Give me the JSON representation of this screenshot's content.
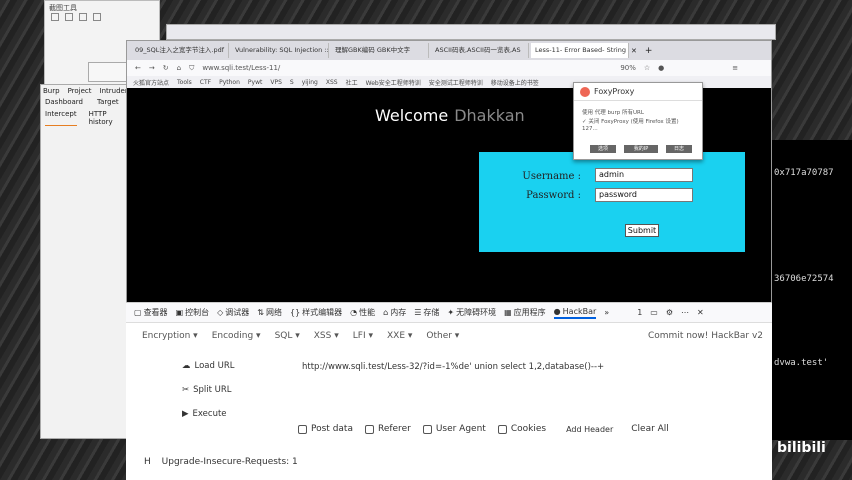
{
  "notes_window": {
    "title": "截图工具"
  },
  "browser": {
    "tabs": [
      {
        "label": "09_SQL注入之宽字节注入.pdf",
        "active": false
      },
      {
        "label": "Vulnerability: SQL Injection :: D",
        "active": false
      },
      {
        "label": "理解GBK编码 GBK中文字",
        "active": false
      },
      {
        "label": "ASCII码表,ASCII码一览表,AS",
        "active": false
      },
      {
        "label": "Less-11- Error Based- String",
        "active": true
      }
    ],
    "url": "www.sqli.test/Less-11/",
    "zoom": "90%",
    "bookmarks": [
      "火狐官方站点",
      "Tools",
      "CTF",
      "Python",
      "Pywt",
      "VPS",
      "S",
      "yijing",
      "XSS",
      "社工",
      "Web安全工程师特训",
      "安全测试工程师特训",
      "移动设备上的书签"
    ]
  },
  "page": {
    "welcome": "Welcome",
    "name": "Dhakkan",
    "username_label": "Username :",
    "username_value": "admin",
    "password_label": "Password :",
    "password_value": "password",
    "submit": "Submit"
  },
  "foxyproxy": {
    "title": "FoxyProxy",
    "lines": [
      "使用 代理 burp 所有URL",
      "✓ 关闭 FoxyProxy (使用 Firefox 设置)",
      "127..."
    ],
    "buttons": [
      "选项",
      "我的IP",
      "日志"
    ]
  },
  "burp": {
    "menu": [
      "Burp",
      "Project",
      "Intruder"
    ],
    "tabs": [
      "Dashboard",
      "Target"
    ],
    "subtabs": [
      "Intercept",
      "HTTP history"
    ]
  },
  "terminal": {
    "lines": [
      "0x717a70787",
      "36706e72574",
      "dvwa.test'"
    ]
  },
  "devtools": {
    "tools": [
      {
        "icon": "▢",
        "label": "查看器"
      },
      {
        "icon": "▣",
        "label": "控制台"
      },
      {
        "icon": "◇",
        "label": "调试器"
      },
      {
        "icon": "⇅",
        "label": "网络"
      },
      {
        "icon": "{}",
        "label": "样式编辑器"
      },
      {
        "icon": "◔",
        "label": "性能"
      },
      {
        "icon": "⌂",
        "label": "内存"
      },
      {
        "icon": "☰",
        "label": "存储"
      },
      {
        "icon": "✦",
        "label": "无障碍环境"
      },
      {
        "icon": "▦",
        "label": "应用程序"
      },
      {
        "icon": "●",
        "label": "HackBar"
      }
    ],
    "error_count": "1"
  },
  "hackbar": {
    "menus": [
      "Encryption ▾",
      "Encoding ▾",
      "SQL ▾",
      "XSS ▾",
      "LFI ▾",
      "XXE ▾",
      "Other ▾"
    ],
    "commit": "Commit now! HackBar v2",
    "load_url": "Load URL",
    "split_url": "Split URL",
    "execute": "Execute",
    "url_value": "http://www.sqli.test/Less-32/?id=-1%de' union select 1,2,database()--+",
    "options": [
      "Post data",
      "Referer",
      "User Agent",
      "Cookies"
    ],
    "add_header": "Add Header",
    "clear_all": "Clear All",
    "header_line": "Upgrade-Insecure-Requests: 1",
    "header_mark": "H"
  },
  "watermark": "bilibili"
}
